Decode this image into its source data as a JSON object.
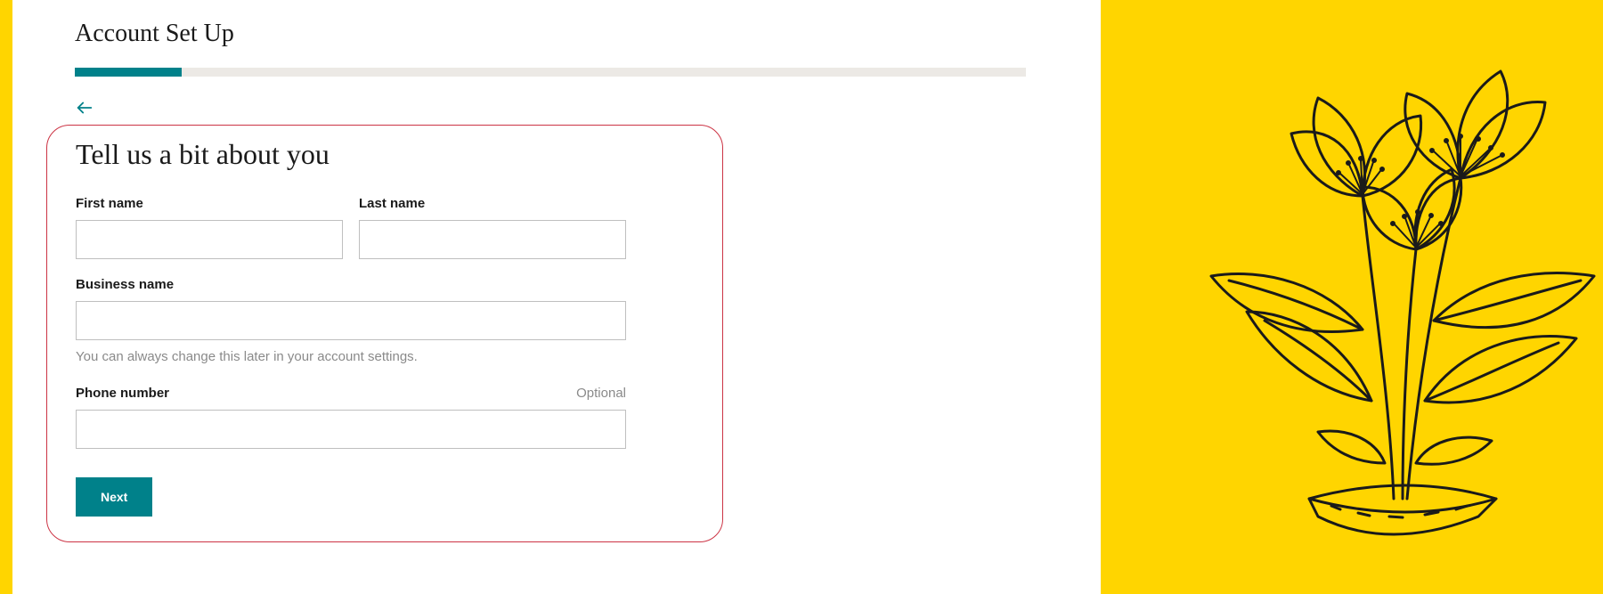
{
  "page": {
    "title": "Account Set Up"
  },
  "form": {
    "heading": "Tell us a bit about you",
    "first_name": {
      "label": "First name",
      "value": ""
    },
    "last_name": {
      "label": "Last name",
      "value": ""
    },
    "business_name": {
      "label": "Business name",
      "value": "",
      "helper": "You can always change this later in your account settings."
    },
    "phone": {
      "label": "Phone number",
      "optional_label": "Optional",
      "value": ""
    },
    "next_button": "Next"
  }
}
